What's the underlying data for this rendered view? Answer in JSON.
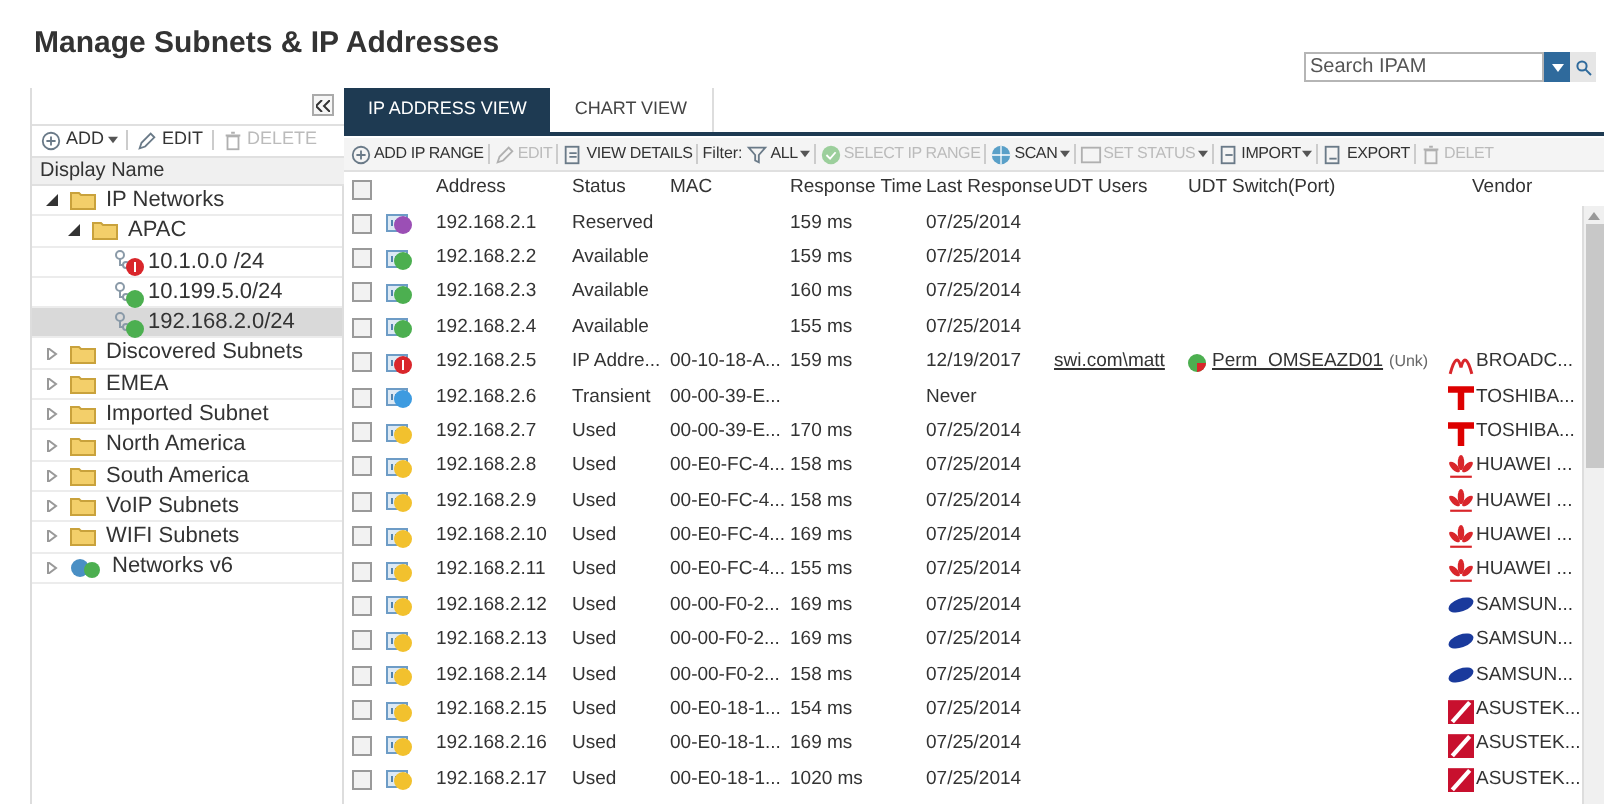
{
  "page_title": "Manage Subnets & IP Addresses",
  "search": {
    "placeholder": "Search IPAM"
  },
  "tree_panel": {
    "toolbar": [
      {
        "label": "ADD",
        "kind": "add",
        "disabled": false
      },
      {
        "label": "EDIT",
        "kind": "edit",
        "disabled": false
      },
      {
        "label": "DELETE",
        "kind": "delete",
        "disabled": true
      }
    ],
    "header": "Display Name",
    "nodes": [
      {
        "kind": "folder",
        "label": "IP Networks",
        "expanded": true,
        "selected": false,
        "children": [
          {
            "kind": "folder",
            "label": "APAC",
            "expanded": true,
            "selected": false,
            "children": [
              {
                "kind": "subnet",
                "label": "10.1.0.0 /24",
                "color": "#d9262b",
                "alert": true,
                "selected": false
              },
              {
                "kind": "subnet",
                "label": "10.199.5.0/24",
                "color": "#4caf50",
                "alert": false,
                "selected": false
              },
              {
                "kind": "subnet",
                "label": "192.168.2.0/24",
                "color": "#4caf50",
                "alert": false,
                "selected": true
              }
            ]
          }
        ]
      },
      {
        "kind": "folder",
        "label": "Discovered Subnets",
        "expanded": false,
        "selected": false
      },
      {
        "kind": "folder",
        "label": "EMEA",
        "expanded": false,
        "selected": false
      },
      {
        "kind": "folder",
        "label": "Imported Subnet",
        "expanded": false,
        "selected": false
      },
      {
        "kind": "folder",
        "label": "North America",
        "expanded": false,
        "selected": false
      },
      {
        "kind": "folder",
        "label": "South America",
        "expanded": false,
        "selected": false
      },
      {
        "kind": "folder",
        "label": "VoIP Subnets",
        "expanded": false,
        "selected": false
      },
      {
        "kind": "folder",
        "label": "WIFI Subnets",
        "expanded": false,
        "selected": false
      },
      {
        "kind": "v6",
        "label": "Networks v6",
        "expanded": false,
        "selected": false
      }
    ]
  },
  "tabs": [
    {
      "label": "IP ADDRESS VIEW",
      "selected": true
    },
    {
      "label": "CHART VIEW",
      "selected": false
    }
  ],
  "toolbar": [
    {
      "kind": "add",
      "label": "ADD IP RANGE",
      "disabled": false,
      "menu": false
    },
    {
      "kind": "edit",
      "label": "EDIT",
      "disabled": true,
      "menu": false
    },
    {
      "kind": "details",
      "label": "VIEW DETAILS",
      "disabled": false,
      "menu": false
    },
    {
      "kind": "filter",
      "label": "Filter:"
    },
    {
      "kind": "funnel",
      "label": "ALL",
      "disabled": false,
      "menu": true
    },
    {
      "kind": "select",
      "label": "SELECT IP RANGE",
      "disabled": true,
      "menu": false
    },
    {
      "kind": "scan",
      "label": "SCAN",
      "disabled": false,
      "menu": true
    },
    {
      "kind": "status",
      "label": "SET STATUS",
      "disabled": true,
      "menu": true
    },
    {
      "kind": "import",
      "label": "IMPORT",
      "disabled": false,
      "menu": true
    },
    {
      "kind": "export",
      "label": "EXPORT",
      "disabled": false,
      "menu": false
    },
    {
      "kind": "delete",
      "label": "DELET",
      "disabled": true,
      "menu": false
    }
  ],
  "table": {
    "select_all_checked": false,
    "columns": [
      "Address",
      "Status",
      "MAC",
      "Response Time",
      "Last Response",
      "UDT Users",
      "UDT Switch(Port)",
      "Vendor"
    ],
    "rows": [
      {
        "address": "192.168.2.1",
        "status": "Reserved",
        "color": "#9b4fb5",
        "alert": false,
        "checked": false,
        "mac": "",
        "response_time": "159 ms",
        "last_response": "07/25/2014"
      },
      {
        "address": "192.168.2.2",
        "status": "Available",
        "color": "#4caf50",
        "alert": false,
        "checked": false,
        "mac": "",
        "response_time": "159 ms",
        "last_response": "07/25/2014"
      },
      {
        "address": "192.168.2.3",
        "status": "Available",
        "color": "#4caf50",
        "alert": false,
        "checked": false,
        "mac": "",
        "response_time": "160 ms",
        "last_response": "07/25/2014"
      },
      {
        "address": "192.168.2.4",
        "status": "Available",
        "color": "#4caf50",
        "alert": false,
        "checked": false,
        "mac": "",
        "response_time": "155 ms",
        "last_response": "07/25/2014"
      },
      {
        "address": "192.168.2.5",
        "status": "IP Addre...",
        "color": "#d9262b",
        "alert": true,
        "checked": false,
        "mac": "00-10-18-A...",
        "response_time": "159 ms",
        "last_response": "12/19/2017",
        "udt_user": "swi.com\\matt",
        "udt_switch": {
          "name": "Perm_OMSEAZD01",
          "port": "(Unk)"
        },
        "vendor": {
          "kind": "arc",
          "name": "BROADC..."
        }
      },
      {
        "address": "192.168.2.6",
        "status": "Transient",
        "color": "#3d9be0",
        "alert": false,
        "checked": false,
        "mac": "00-00-39-E...",
        "response_time": "",
        "last_response": "Never",
        "vendor": {
          "kind": "tee",
          "name": "TOSHIBA..."
        }
      },
      {
        "address": "192.168.2.7",
        "status": "Used",
        "color": "#f2c12e",
        "alert": false,
        "checked": false,
        "mac": "00-00-39-E...",
        "response_time": "170 ms",
        "last_response": "07/25/2014",
        "vendor": {
          "kind": "tee",
          "name": "TOSHIBA..."
        }
      },
      {
        "address": "192.168.2.8",
        "status": "Used",
        "color": "#f2c12e",
        "alert": false,
        "checked": false,
        "mac": "00-E0-FC-4...",
        "response_time": "158 ms",
        "last_response": "07/25/2014",
        "vendor": {
          "kind": "petals",
          "name": "HUAWEI ..."
        }
      },
      {
        "address": "192.168.2.9",
        "status": "Used",
        "color": "#f2c12e",
        "alert": false,
        "checked": false,
        "mac": "00-E0-FC-4...",
        "response_time": "158 ms",
        "last_response": "07/25/2014",
        "vendor": {
          "kind": "petals",
          "name": "HUAWEI ..."
        }
      },
      {
        "address": "192.168.2.10",
        "status": "Used",
        "color": "#f2c12e",
        "alert": false,
        "checked": false,
        "mac": "00-E0-FC-4...",
        "response_time": "169 ms",
        "last_response": "07/25/2014",
        "vendor": {
          "kind": "petals",
          "name": "HUAWEI ..."
        }
      },
      {
        "address": "192.168.2.11",
        "status": "Used",
        "color": "#f2c12e",
        "alert": false,
        "checked": false,
        "mac": "00-E0-FC-4...",
        "response_time": "155 ms",
        "last_response": "07/25/2014",
        "vendor": {
          "kind": "petals",
          "name": "HUAWEI ..."
        }
      },
      {
        "address": "192.168.2.12",
        "status": "Used",
        "color": "#f2c12e",
        "alert": false,
        "checked": false,
        "mac": "00-00-F0-2...",
        "response_time": "169 ms",
        "last_response": "07/25/2014",
        "vendor": {
          "kind": "ellipse",
          "name": "SAMSUN..."
        }
      },
      {
        "address": "192.168.2.13",
        "status": "Used",
        "color": "#f2c12e",
        "alert": false,
        "checked": false,
        "mac": "00-00-F0-2...",
        "response_time": "169 ms",
        "last_response": "07/25/2014",
        "vendor": {
          "kind": "ellipse",
          "name": "SAMSUN..."
        }
      },
      {
        "address": "192.168.2.14",
        "status": "Used",
        "color": "#f2c12e",
        "alert": false,
        "checked": false,
        "mac": "00-00-F0-2...",
        "response_time": "158 ms",
        "last_response": "07/25/2014",
        "vendor": {
          "kind": "ellipse",
          "name": "SAMSUN..."
        }
      },
      {
        "address": "192.168.2.15",
        "status": "Used",
        "color": "#f2c12e",
        "alert": false,
        "checked": false,
        "mac": "00-E0-18-1...",
        "response_time": "154 ms",
        "last_response": "07/25/2014",
        "vendor": {
          "kind": "slash",
          "name": "ASUSTEK..."
        }
      },
      {
        "address": "192.168.2.16",
        "status": "Used",
        "color": "#f2c12e",
        "alert": false,
        "checked": false,
        "mac": "00-E0-18-1...",
        "response_time": "169 ms",
        "last_response": "07/25/2014",
        "vendor": {
          "kind": "slash",
          "name": "ASUSTEK..."
        }
      },
      {
        "address": "192.168.2.17",
        "status": "Used",
        "color": "#f2c12e",
        "alert": false,
        "checked": false,
        "mac": "00-E0-18-1...",
        "response_time": "1020 ms",
        "last_response": "07/25/2014",
        "vendor": {
          "kind": "slash",
          "name": "ASUSTEK..."
        }
      }
    ]
  }
}
